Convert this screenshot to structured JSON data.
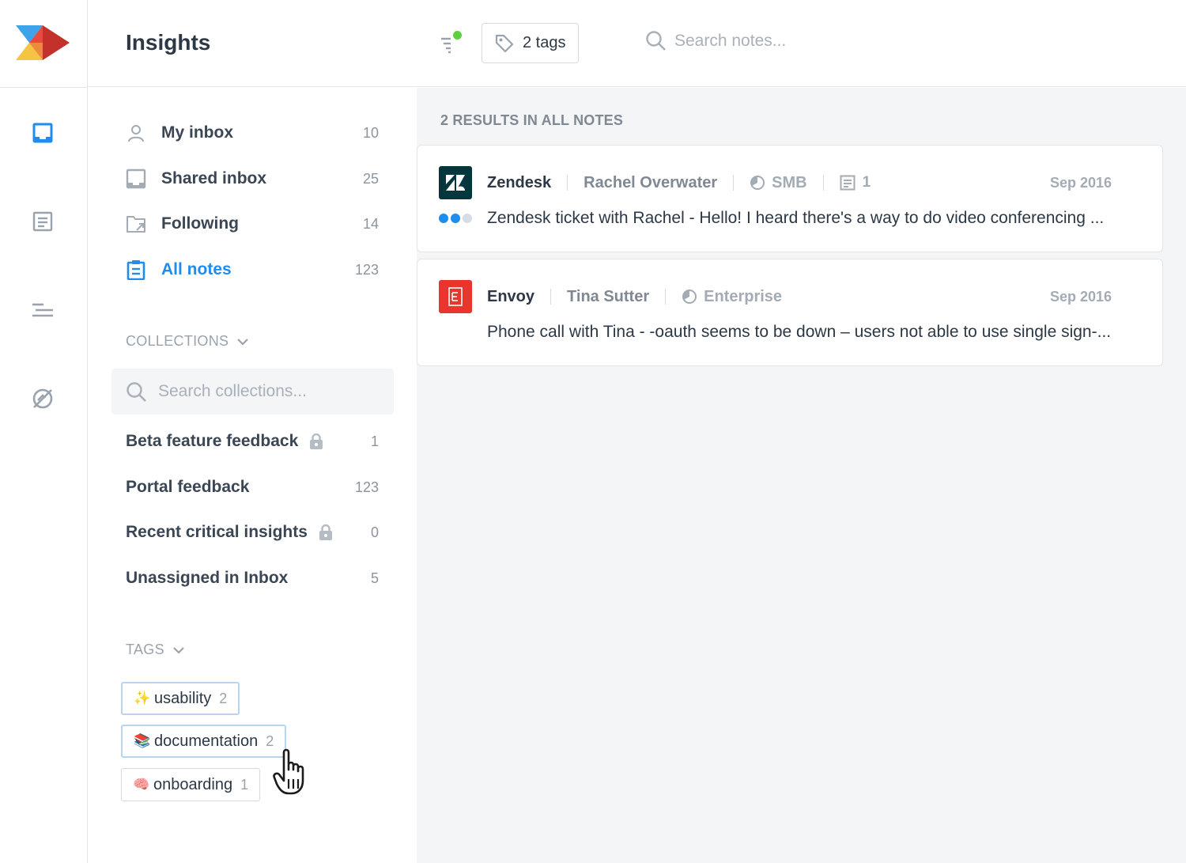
{
  "header": {
    "title": "Insights",
    "tags_button_label": "2 tags",
    "search_placeholder": "Search notes..."
  },
  "nav": {
    "items": [
      {
        "label": "My inbox",
        "count": "10",
        "icon": "person-icon"
      },
      {
        "label": "Shared inbox",
        "count": "25",
        "icon": "inbox-icon"
      },
      {
        "label": "Following",
        "count": "14",
        "icon": "following-folder-icon"
      },
      {
        "label": "All notes",
        "count": "123",
        "icon": "clipboard-icon",
        "active": true
      }
    ]
  },
  "collections": {
    "heading": "COLLECTIONS",
    "search_placeholder": "Search collections...",
    "items": [
      {
        "label": "Beta feature feedback",
        "count": "1",
        "locked": true
      },
      {
        "label": "Portal feedback",
        "count": "123",
        "locked": false
      },
      {
        "label": "Recent critical insights",
        "count": "0",
        "locked": true
      },
      {
        "label": "Unassigned in Inbox",
        "count": "5",
        "locked": false
      }
    ]
  },
  "tags": {
    "heading": "TAGS",
    "items": [
      {
        "emoji": "✨",
        "label": "usability",
        "count": "2",
        "selected": true
      },
      {
        "emoji": "📚",
        "label": "documentation",
        "count": "2",
        "selected": true
      },
      {
        "emoji": "🧠",
        "label": "onboarding",
        "count": "1",
        "selected": false
      }
    ]
  },
  "results": {
    "heading": "2 RESULTS IN ALL NOTES",
    "notes": [
      {
        "source": "Zendesk",
        "person": "Rachel Overwater",
        "segment": "SMB",
        "linked_count": "1",
        "date": "Sep 2016",
        "snippet": "Zendesk ticket with Rachel - Hello! I heard there's a way to do video conferencing ...",
        "logo_color": "#03363d",
        "importance": 2
      },
      {
        "source": "Envoy",
        "person": "Tina Sutter",
        "segment": "Enterprise",
        "date": "Sep 2016",
        "snippet": "Phone call with Tina - -oauth seems to be down – users not able to use single sign-...",
        "logo_color": "#e8352e"
      }
    ]
  },
  "colors": {
    "accent": "#1f8ded",
    "status_dot": "#5bd13d"
  }
}
